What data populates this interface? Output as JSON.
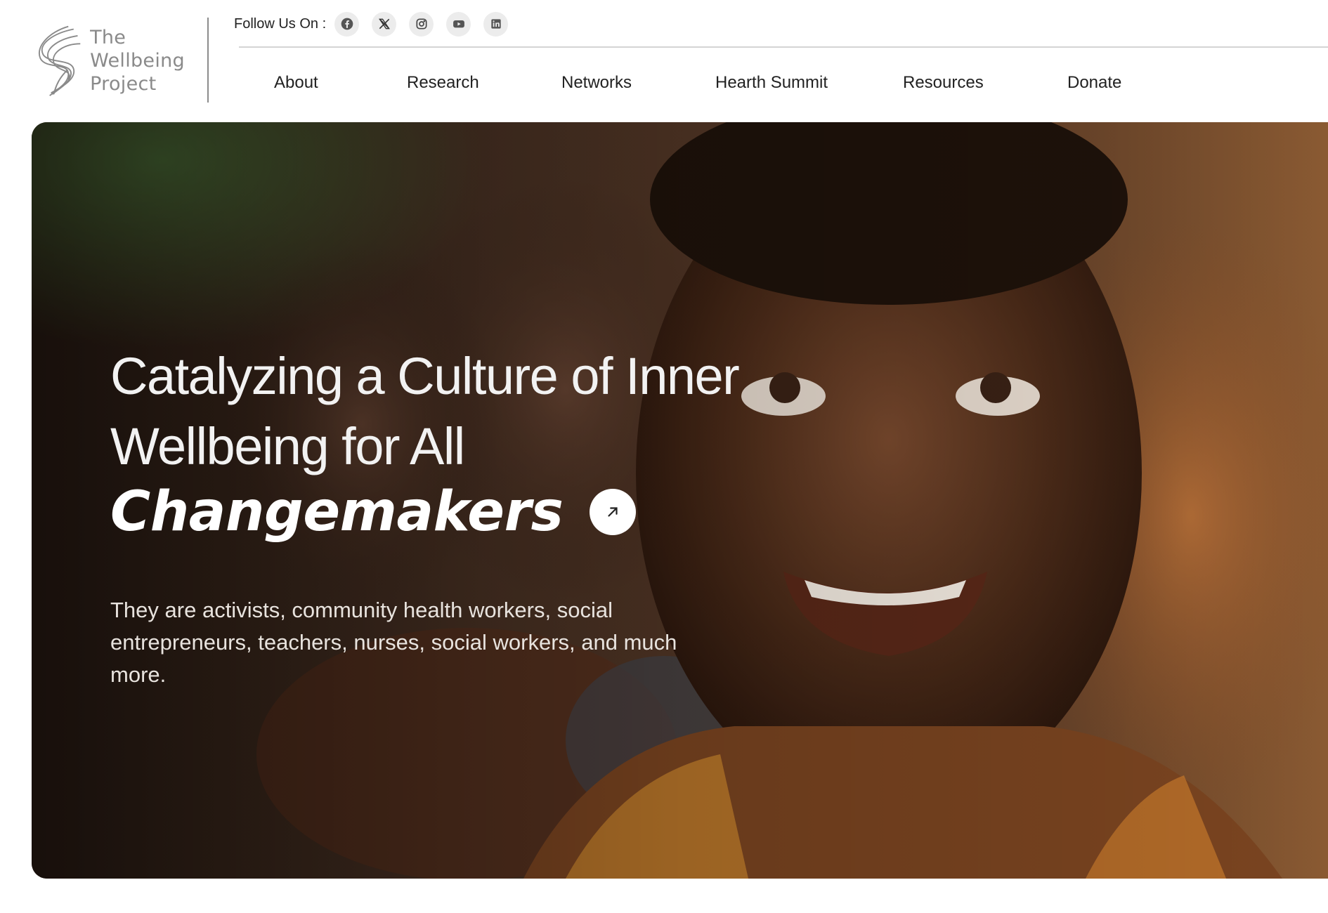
{
  "brand": {
    "logo_lines": [
      "The",
      "Wellbeing",
      "Project"
    ],
    "logo_color": "#8a8a8a"
  },
  "social": {
    "label": "Follow Us On :",
    "icons": [
      "facebook-icon",
      "x-icon",
      "instagram-icon",
      "youtube-icon",
      "linkedin-icon"
    ]
  },
  "nav": {
    "items": [
      "About",
      "Research",
      "Networks",
      "Hearth Summit",
      "Resources",
      "Donate"
    ]
  },
  "hero": {
    "heading_line1": "Catalyzing a Culture of Inner",
    "heading_line2": "Wellbeing for All",
    "heading_strong": "Changemakers",
    "subtext": "They are activists, community health workers, social entrepreneurs, teachers, nurses, social workers, and much more.",
    "arrow_icon": "arrow-up-right-icon",
    "image": "photo-smiling-child-looking-up",
    "overlay_color": "#3a2418"
  }
}
